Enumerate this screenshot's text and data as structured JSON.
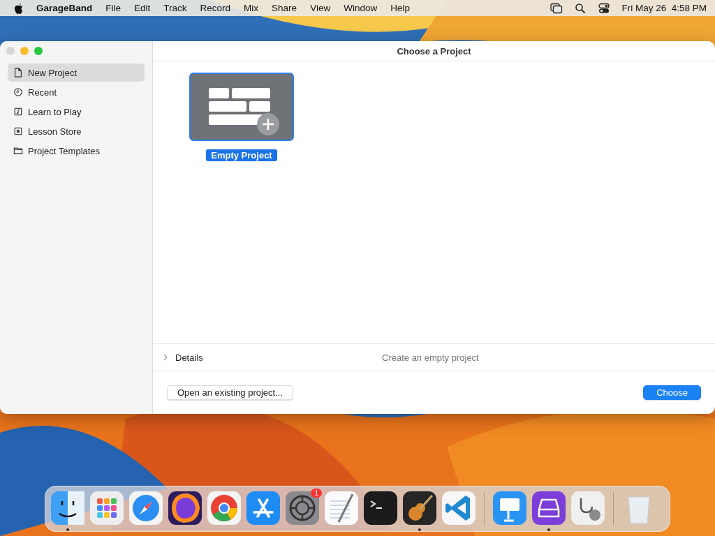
{
  "menu_bar": {
    "app": "GarageBand",
    "items": [
      "File",
      "Edit",
      "Track",
      "Record",
      "Mix",
      "Share",
      "View",
      "Window",
      "Help"
    ],
    "clock": "Fri May 26  4:58 PM"
  },
  "window": {
    "title": "Choose a Project",
    "sidebar": [
      {
        "label": "New Project",
        "selected": true
      },
      {
        "label": "Recent",
        "selected": false
      },
      {
        "label": "Learn to Play",
        "selected": false
      },
      {
        "label": "Lesson Store",
        "selected": false
      },
      {
        "label": "Project Templates",
        "selected": false
      }
    ],
    "projects": [
      {
        "label": "Empty Project",
        "selected": true
      }
    ],
    "details": {
      "label": "Details",
      "expanded": false,
      "description": "Create an empty project"
    },
    "buttons": {
      "open": "Open an existing project...",
      "choose": "Choose"
    }
  },
  "dock": {
    "groups": [
      [
        {
          "running": true
        },
        {
          "running": false
        },
        {
          "running": false
        },
        {
          "running": false
        },
        {
          "running": false
        },
        {
          "running": false
        },
        {
          "running": false,
          "badge": "1"
        },
        {
          "running": false
        },
        {
          "running": false
        },
        {
          "running": true
        },
        {
          "running": false
        }
      ],
      [
        {
          "running": false
        },
        {
          "running": true
        },
        {
          "running": false
        }
      ],
      [
        {
          "running": false
        }
      ]
    ]
  }
}
